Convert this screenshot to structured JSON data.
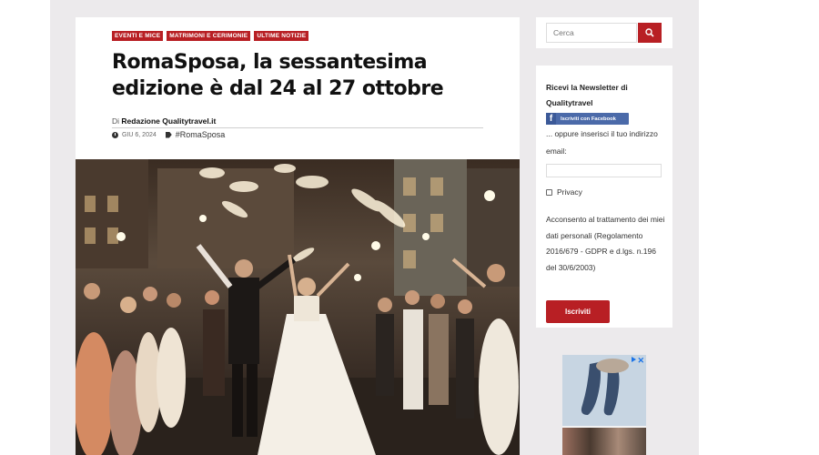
{
  "article": {
    "categories": [
      "EVENTI E MICE",
      "MATRIMONI E CERIMONIE",
      "ULTIME NOTIZIE"
    ],
    "title": "RomaSposa, la sessantesima edizione è dal 24 al 27 ottobre",
    "byline_prefix": "Di",
    "author": "Redazione Qualitytravel.it",
    "date": "GIU 6, 2024",
    "tag": "#RomaSposa"
  },
  "sidebar": {
    "search_placeholder": "Cerca",
    "newsletter": {
      "title": "Ricevi la Newsletter di Qualitytravel",
      "facebook_label": "Iscriviti con Facebook",
      "or_text": "... oppure inserisci il tuo indirizzo email:",
      "privacy_label": "Privacy",
      "consent": "Acconsento al trattamento dei miei dati personali (Regolamento 2016/679 - GDPR e d.lgs. n.196 del 30/6/2003)",
      "subscribe_label": "Iscriviti"
    },
    "ad": {
      "close": "✕"
    }
  },
  "colors": {
    "accent": "#b81f24",
    "facebook": "#4b6aa9",
    "page_bg": "#eceaec"
  },
  "icons": [
    "search-icon",
    "clock-icon",
    "tag-icon",
    "facebook-icon",
    "adchoices-icon",
    "close-icon"
  ]
}
